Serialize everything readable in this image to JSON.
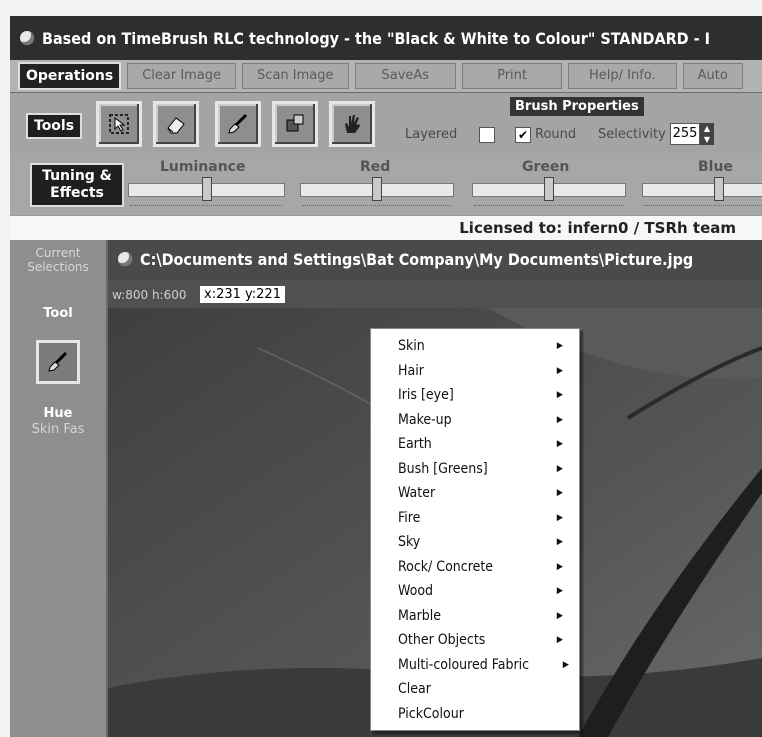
{
  "window": {
    "title": "Based on TimeBrush RLC technology - the \"Black & White to Colour\" STANDARD - I"
  },
  "operations": {
    "label": "Operations",
    "tabs": [
      {
        "label": "Clear Image"
      },
      {
        "label": "Scan Image"
      },
      {
        "label": "SaveAs"
      },
      {
        "label": "Print"
      },
      {
        "label": "Help/ Info."
      },
      {
        "label": "Auto"
      }
    ]
  },
  "tools": {
    "label": "Tools",
    "buttons": [
      {
        "icon": "select-tool-icon"
      },
      {
        "icon": "eraser-tool-icon"
      },
      {
        "icon": "brush-tool-icon"
      },
      {
        "icon": "fill-tool-icon"
      },
      {
        "icon": "hand-tool-icon"
      }
    ],
    "layered_label": "Layered",
    "layered_checked": false
  },
  "brush_properties": {
    "title": "Brush Properties",
    "round_label": "Round",
    "round_checked": true,
    "selectivity_label": "Selectivity",
    "selectivity_value": "255"
  },
  "tuning": {
    "label": "Tuning & Effects",
    "sliders": [
      {
        "label": "Luminance"
      },
      {
        "label": "Red"
      },
      {
        "label": "Green"
      },
      {
        "label": "Blue"
      }
    ]
  },
  "license": {
    "text": "Licensed to: infern0 / TSRh team"
  },
  "current_selections": {
    "title": "Current Selections",
    "tool_label": "Tool",
    "hue_label": "Hue",
    "hue_value": "Skin Fas"
  },
  "document": {
    "path": "C:\\Documents and Settings\\Bat Company\\My Documents\\Picture.jpg",
    "width_label": "w:800",
    "height_label": "h:600",
    "coords": "x:231  y:221"
  },
  "context_menu": {
    "items": [
      {
        "label": "Skin",
        "submenu": true
      },
      {
        "label": "Hair",
        "submenu": true
      },
      {
        "label": "Iris [eye]",
        "submenu": true
      },
      {
        "label": "Make-up",
        "submenu": true
      },
      {
        "label": "Earth",
        "submenu": true
      },
      {
        "label": "Bush [Greens]",
        "submenu": true
      },
      {
        "label": "Water",
        "submenu": true
      },
      {
        "label": "Fire",
        "submenu": true
      },
      {
        "label": "Sky",
        "submenu": true
      },
      {
        "label": "Rock/ Concrete",
        "submenu": true
      },
      {
        "label": "Wood",
        "submenu": true
      },
      {
        "label": "Marble",
        "submenu": true
      },
      {
        "label": "Other Objects",
        "submenu": true
      },
      {
        "label": "Multi-coloured Fabric",
        "submenu": true
      },
      {
        "label": "Clear",
        "submenu": false
      },
      {
        "label": "PickColour",
        "submenu": false
      }
    ]
  }
}
